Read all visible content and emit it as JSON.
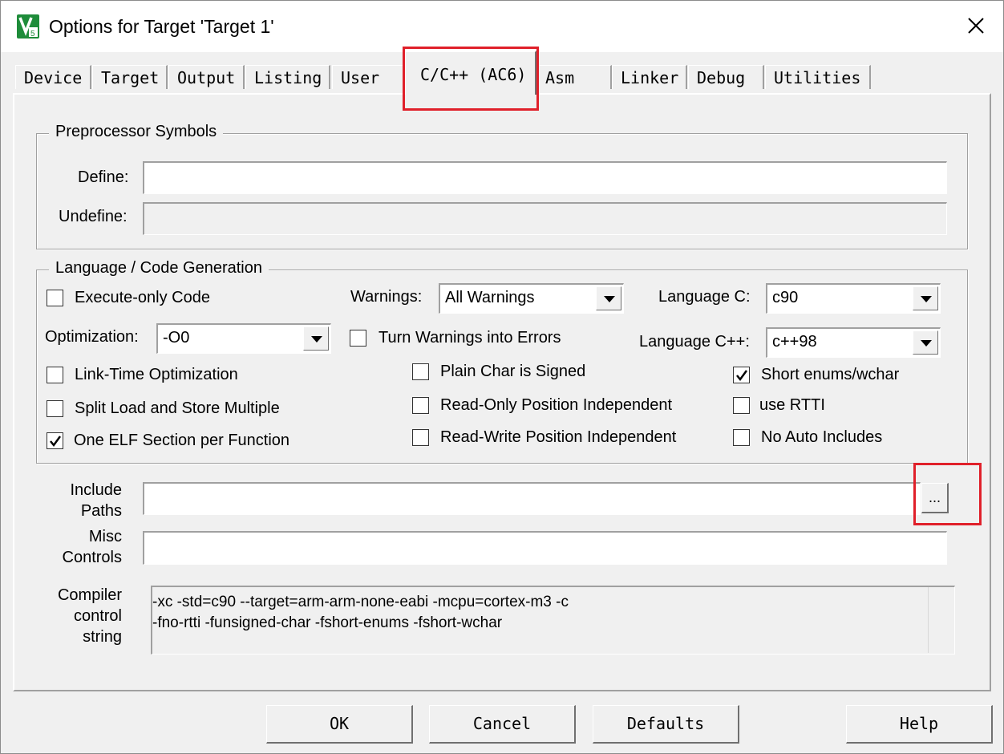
{
  "window": {
    "title": "Options for Target 'Target 1'",
    "close_glyph": "✕"
  },
  "tabs": [
    {
      "label": "Device"
    },
    {
      "label": "Target"
    },
    {
      "label": "Output"
    },
    {
      "label": "Listing"
    },
    {
      "label": "User"
    },
    {
      "label": "C/C++ (AC6)",
      "active": true
    },
    {
      "label": "Asm"
    },
    {
      "label": "Linker"
    },
    {
      "label": "Debug"
    },
    {
      "label": "Utilities"
    }
  ],
  "preprocessor": {
    "group_label": "Preprocessor Symbols",
    "define_label": "Define:",
    "define_value": "",
    "undefine_label": "Undefine:",
    "undefine_value": ""
  },
  "codegen": {
    "group_label": "Language / Code Generation",
    "execute_only": {
      "label": "Execute-only Code",
      "checked": false
    },
    "warnings_label": "Warnings:",
    "warnings_value": "All Warnings",
    "language_c_label": "Language C:",
    "language_c_value": "c90",
    "optimization_label": "Optimization:",
    "optimization_value": "-O0",
    "turn_warnings": {
      "label": "Turn Warnings into Errors",
      "checked": false
    },
    "language_cpp_label": "Language C++:",
    "language_cpp_value": "c++98",
    "link_time": {
      "label": "Link-Time Optimization",
      "checked": false
    },
    "plain_char": {
      "label": "Plain Char is Signed",
      "checked": false
    },
    "short_enums": {
      "label": "Short enums/wchar",
      "checked": true
    },
    "split_load": {
      "label": "Split Load and Store Multiple",
      "checked": false
    },
    "ro_pi": {
      "label": "Read-Only Position Independent",
      "checked": false
    },
    "use_rtti": {
      "label": "use RTTI",
      "checked": false
    },
    "one_elf": {
      "label": "One ELF Section per Function",
      "checked": true
    },
    "rw_pi": {
      "label": "Read-Write Position Independent",
      "checked": false
    },
    "no_auto_includes": {
      "label": "No Auto Includes",
      "checked": false
    }
  },
  "include": {
    "label_line1": "Include",
    "label_line2": "Paths",
    "value": "",
    "browse_label": "..."
  },
  "misc": {
    "label_line1": "Misc",
    "label_line2": "Controls",
    "value": ""
  },
  "compiler": {
    "label_line1": "Compiler",
    "label_line2": "control",
    "label_line3": "string",
    "line1": "-xc -std=c90 --target=arm-arm-none-eabi -mcpu=cortex-m3 -c",
    "line2": "-fno-rtti -funsigned-char -fshort-enums -fshort-wchar"
  },
  "buttons": {
    "ok": "OK",
    "cancel": "Cancel",
    "defaults": "Defaults",
    "help": "Help"
  },
  "colors": {
    "highlight": "#e0202a",
    "app_icon": "#1e8c3a"
  }
}
